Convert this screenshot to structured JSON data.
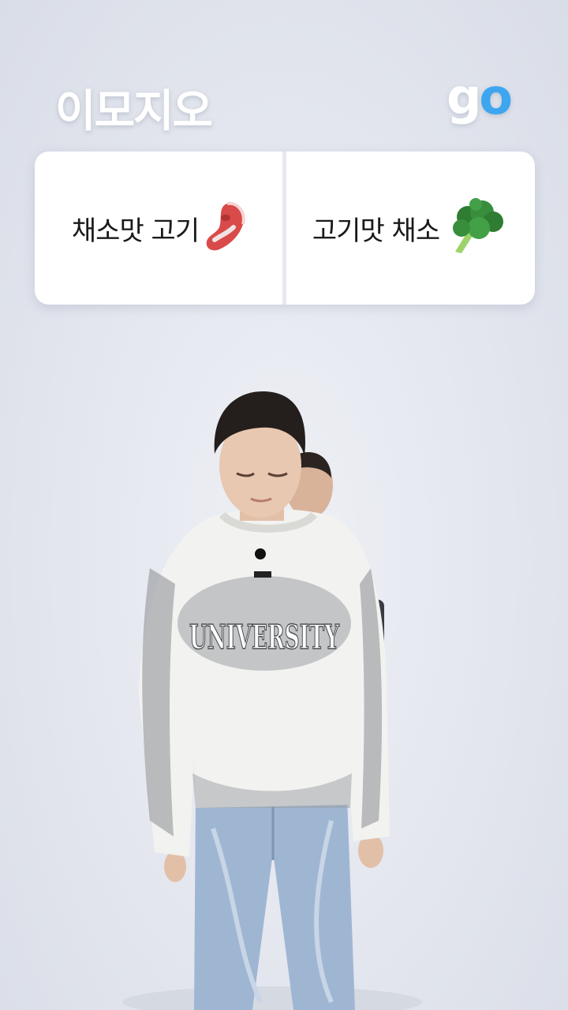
{
  "header": {
    "brand_text": "이모지오",
    "go_g": "g",
    "go_o": "o"
  },
  "card": {
    "left_label": "채소맛 고기",
    "left_icon": "steak-emoji-icon",
    "right_label": "고기맛 채소",
    "right_icon": "broccoli-emoji-icon"
  },
  "scene": {
    "sweater_text": "UNIVERSITY"
  },
  "colors": {
    "go_accent": "#3ea6f0",
    "background": "#e3e6ee",
    "card": "#ffffff"
  }
}
